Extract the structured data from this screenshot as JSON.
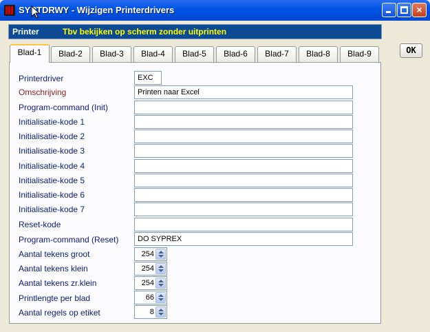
{
  "window": {
    "title": "SYPTDRWY - Wijzigen Printerdrivers",
    "controls": {
      "minimize": "minimize-icon",
      "maximize": "maximize-icon",
      "close": "×"
    }
  },
  "header": {
    "label": "Printer",
    "description": "Tbv bekijken op scherm zonder uitprinten"
  },
  "tabs": [
    {
      "label": "Blad-1",
      "active": true
    },
    {
      "label": "Blad-2"
    },
    {
      "label": "Blad-3"
    },
    {
      "label": "Blad-4"
    },
    {
      "label": "Blad-5"
    },
    {
      "label": "Blad-6"
    },
    {
      "label": "Blad-7"
    },
    {
      "label": "Blad-8"
    },
    {
      "label": "Blad-9"
    }
  ],
  "ok_label": "OK",
  "form": {
    "fields": [
      {
        "label": "Printerdriver",
        "value": "EXC"
      },
      {
        "label": "Omschrijving",
        "value": "Printen naar Excel"
      },
      {
        "label": "Program-command (Init)",
        "value": ""
      },
      {
        "label": "Initialisatie-kode 1",
        "value": ""
      },
      {
        "label": "Initialisatie-kode 2",
        "value": ""
      },
      {
        "label": "Initialisatie-kode 3",
        "value": ""
      },
      {
        "label": "Initialisatie-kode 4",
        "value": ""
      },
      {
        "label": "Initialisatie-kode 5",
        "value": ""
      },
      {
        "label": "Initialisatie-kode 6",
        "value": ""
      },
      {
        "label": "Initialisatie-kode 7",
        "value": ""
      },
      {
        "label": "Reset-kode",
        "value": ""
      },
      {
        "label": "Program-command (Reset)",
        "value": "DO SYPREX"
      }
    ],
    "spinners": [
      {
        "label": "Aantal tekens groot",
        "value": "254"
      },
      {
        "label": "Aantal tekens klein",
        "value": "254"
      },
      {
        "label": "Aantal tekens zr.klein",
        "value": "254"
      },
      {
        "label": "Printlengte per blad",
        "value": "66"
      },
      {
        "label": "Aantal regels op etiket",
        "value": "8"
      }
    ]
  },
  "colors": {
    "title_bar": "#0055e5",
    "header_bg": "#0c4a93",
    "header_desc": "#ffff00",
    "label_blue": "#0a1b78",
    "label_red": "#8b1a1a",
    "tab_highlight": "#ffc83c"
  }
}
